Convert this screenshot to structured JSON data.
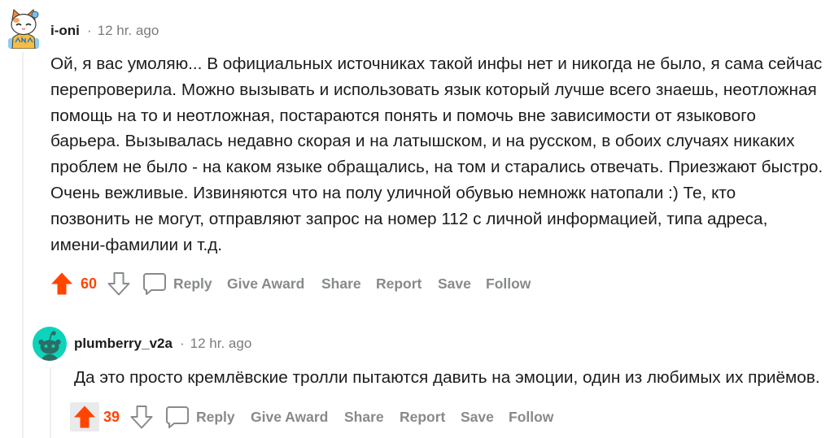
{
  "comments": [
    {
      "author": "i-oni",
      "separator": "·",
      "time": "12 hr. ago",
      "body_lines": [
        "Ой, я вас умоляю... В официальных источниках такой инфы нет и никогда не было, я сама сейчас",
        "перепроверила. Можно вызывать и использовать язык который лучше всего знаешь, неотложная",
        "помощь на то и неотложная, постараются понять и помочь вне зависимости от языкового",
        "барьера. Вызывалась недавно скорая и на латышском, и на русском, в обоих случаях никаких",
        "проблем не было - на каком языке обращались, на том и старались отвечать. Приезжают быстро.",
        "Очень вежливые. Извиняются что на полу уличной обувью немножк натопали :) Те, кто",
        "позвонить не могут, отправляют запрос на номер 112 с личной информацией, типа адреса,",
        "имени-фамилии и т.д."
      ],
      "upvoted": true,
      "score": "60",
      "actions": {
        "reply": "Reply",
        "give_award": "Give Award",
        "share": "Share",
        "report": "Report",
        "save": "Save",
        "follow": "Follow"
      },
      "replies": [
        {
          "author": "plumberry_v2a",
          "separator": "·",
          "time": "12 hr. ago",
          "body_lines": [
            "Да это просто кремлёвские тролли пытаются давить на эмоции, один из любимых их приёмов."
          ],
          "upvoted": true,
          "score": "39",
          "actions": {
            "reply": "Reply",
            "give_award": "Give Award",
            "share": "Share",
            "report": "Report",
            "save": "Save",
            "follow": "Follow"
          }
        }
      ]
    }
  ],
  "icons": {
    "upvote": "upvote-arrow-icon",
    "downvote": "downvote-arrow-icon",
    "comment": "comment-bubble-icon",
    "avatar_1": "user-avatar-cat-icon",
    "avatar_2": "default-snoo-avatar-icon"
  },
  "colors": {
    "upvote": "#ff4500",
    "action_text": "#878a8c",
    "body_text": "#1c1c1c",
    "meta_text": "#7c7c7c",
    "thread_line": "#edeff1",
    "default_avatar_bg": "#0dd3bb"
  }
}
